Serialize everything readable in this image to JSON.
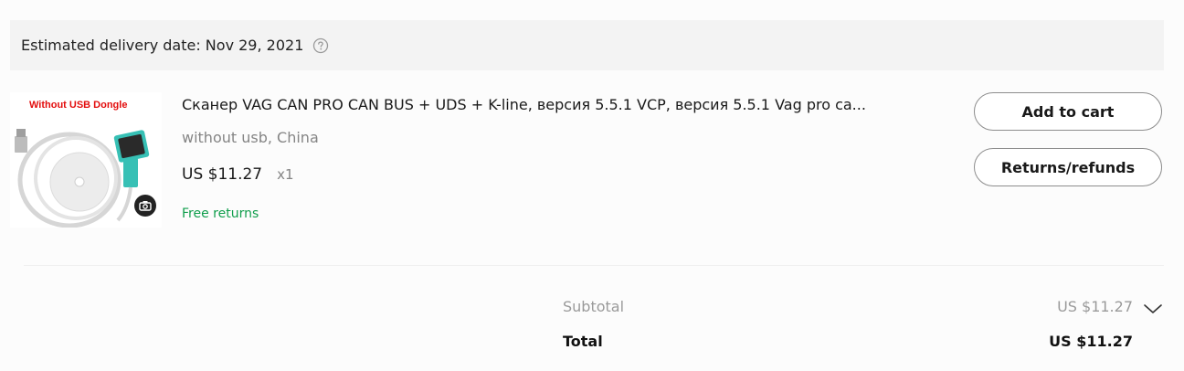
{
  "delivery": {
    "text": "Estimated delivery date: Nov 29, 2021",
    "help_icon": "question-circle-icon"
  },
  "product": {
    "image_tag": "Without USB Dongle",
    "title": "Сканер VAG CAN PRO CAN BUS + UDS + K-line, версия 5.5.1 VCP, версия 5.5.1 Vag pro ca...",
    "variant": "without usb, China",
    "price": "US $11.27",
    "quantity": "x1",
    "free_returns": "Free returns",
    "camera_icon": "camera-icon"
  },
  "actions": {
    "add_to_cart": "Add to cart",
    "returns_refunds": "Returns/refunds"
  },
  "summary": {
    "subtotal_label": "Subtotal",
    "subtotal_value": "US $11.27",
    "total_label": "Total",
    "total_value": "US $11.27",
    "chevron_icon": "chevron-down-icon"
  },
  "colors": {
    "green": "#109e4c",
    "tag_red": "#e30d0d"
  }
}
